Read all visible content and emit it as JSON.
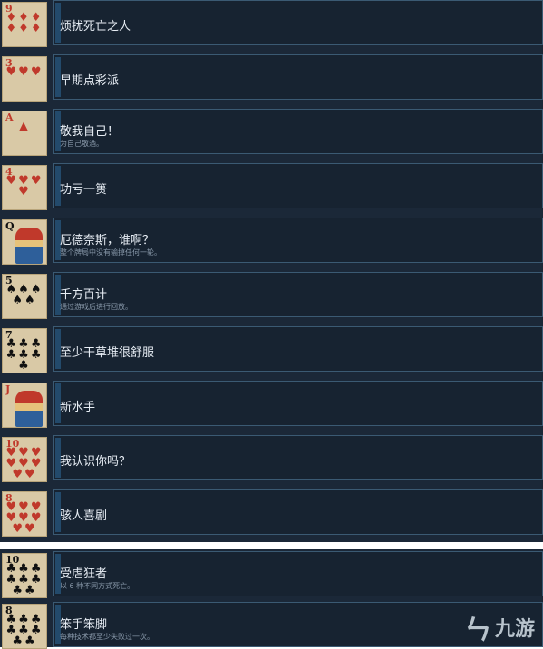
{
  "achievements": [
    {
      "rank": "9",
      "pips": "♦♦♦♦♦♦",
      "suit_color": "red",
      "title": "烦扰死亡之人",
      "desc": ""
    },
    {
      "rank": "3",
      "pips": "♥♥♥",
      "suit_color": "red",
      "title": "早期点彩派",
      "desc": ""
    },
    {
      "rank": "A",
      "pips": "▲",
      "suit_color": "red",
      "title": "敬我自己！",
      "desc": "为自己敬酒。"
    },
    {
      "rank": "4",
      "pips": "♥♥♥♥",
      "suit_color": "red",
      "title": "功亏一篑",
      "desc": ""
    },
    {
      "rank": "Q",
      "pips": "",
      "suit_color": "black",
      "title": "厄德奈斯，谁啊？",
      "desc": "整个牌局中没有输掉任何一轮。"
    },
    {
      "rank": "5",
      "pips": "♠♠♠♠♠",
      "suit_color": "black",
      "title": "千方百计",
      "desc": "通过游戏后进行回放。"
    },
    {
      "rank": "7",
      "pips": "♣♣♣♣♣♣♣",
      "suit_color": "black",
      "title": "至少干草堆很舒服",
      "desc": ""
    },
    {
      "rank": "J",
      "pips": "",
      "suit_color": "red",
      "title": "新水手",
      "desc": ""
    },
    {
      "rank": "10",
      "pips": "♥♥♥♥♥♥♥♥",
      "suit_color": "red",
      "title": "我认识你吗？",
      "desc": ""
    },
    {
      "rank": "8",
      "pips": "♥♥♥♥♥♥♥♥",
      "suit_color": "red",
      "title": "骇人喜剧",
      "desc": ""
    },
    {
      "rank": "10",
      "pips": "♣♣♣♣♣♣♣♣",
      "suit_color": "black",
      "title": "受虐狂者",
      "desc": "以 6 种不同方式死亡。"
    },
    {
      "rank": "8",
      "pips": "♣♣♣♣♣♣♣♣",
      "suit_color": "black",
      "title": "笨手笨脚",
      "desc": "每种技术都至少失败过一次。"
    }
  ],
  "watermark": {
    "icon": "九游-logo-icon",
    "text": "九游"
  }
}
